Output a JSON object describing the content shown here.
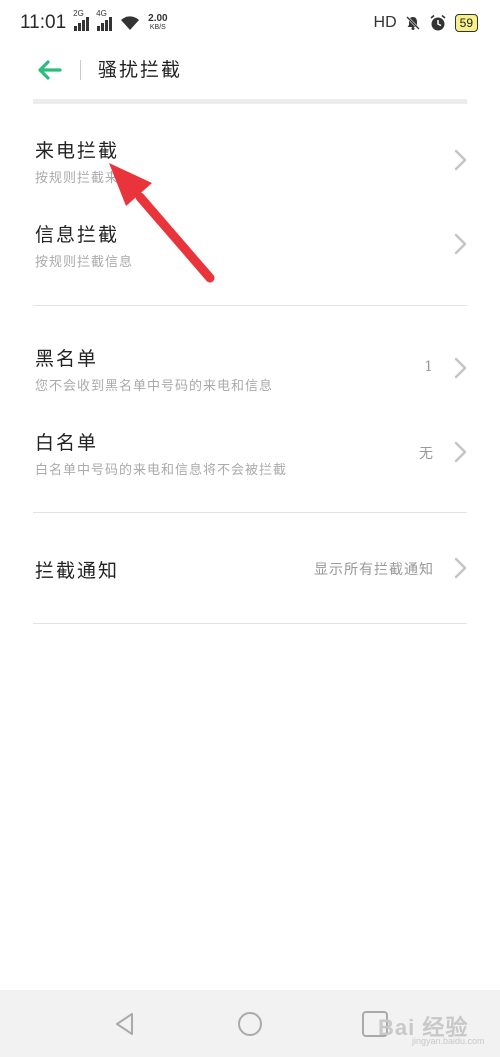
{
  "status_bar": {
    "time": "11:01",
    "sim1": "2G",
    "sim2": "4G",
    "speed_value": "2.00",
    "speed_unit": "KB/S",
    "hd": "HD",
    "battery": "59"
  },
  "header": {
    "title": "骚扰拦截"
  },
  "sections": {
    "calls": {
      "title": "来电拦截",
      "subtitle": "按规则拦截来电"
    },
    "messages": {
      "title": "信息拦截",
      "subtitle": "按规则拦截信息"
    },
    "blacklist": {
      "title": "黑名单",
      "subtitle": "您不会收到黑名单中号码的来电和信息",
      "value": "1"
    },
    "whitelist": {
      "title": "白名单",
      "subtitle": "白名单中号码的来电和信息将不会被拦截",
      "value": "无"
    },
    "notify": {
      "title": "拦截通知",
      "value": "显示所有拦截通知"
    }
  },
  "watermark": {
    "text": "Bai 经验",
    "url": "jingyan.baidu.com"
  },
  "colors": {
    "accent": "#2bbd7e",
    "annotation_arrow": "#e8343a"
  }
}
